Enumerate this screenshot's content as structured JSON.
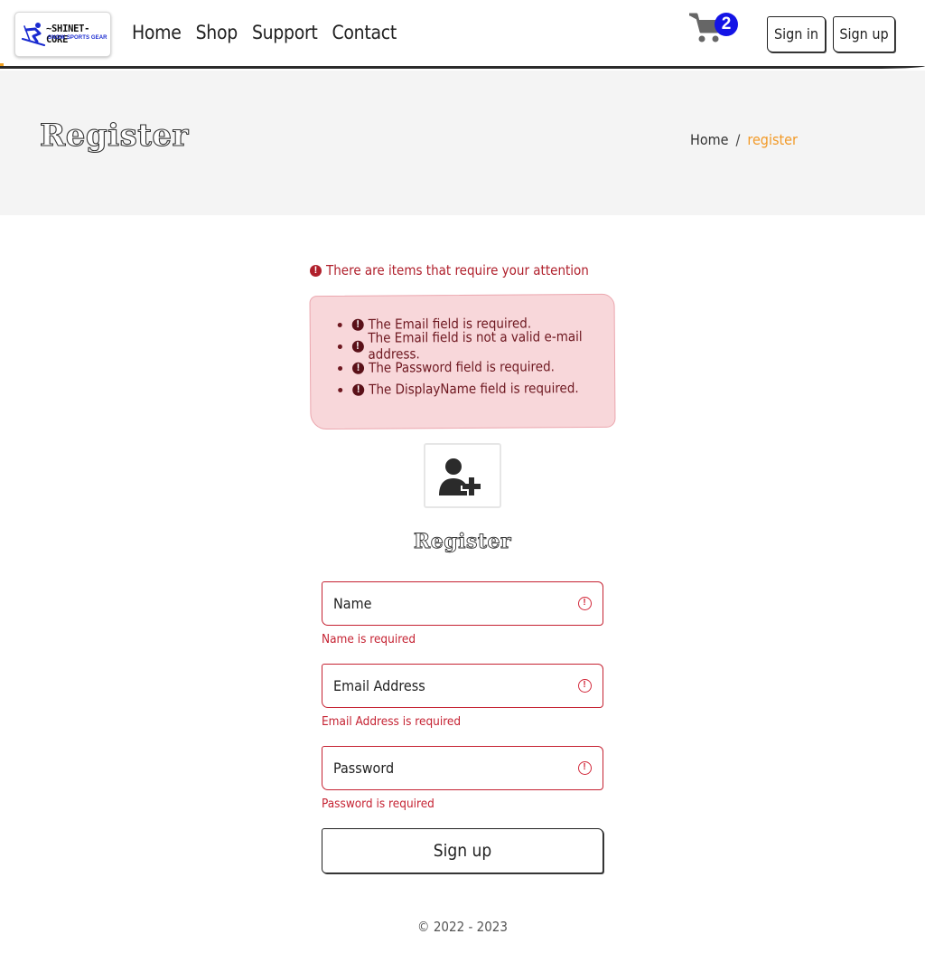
{
  "header": {
    "logo_title": "~SHINET-CORE",
    "logo_subtitle": "SNOW SPORTS GEAR",
    "nav": [
      "Home",
      "Shop",
      "Support",
      "Contact"
    ],
    "cart_count": "2",
    "signin_label": "Sign in",
    "signup_label": "Sign up"
  },
  "banner": {
    "title": "Register",
    "breadcrumb": {
      "home": "Home",
      "separator": "/",
      "current": "register"
    }
  },
  "validation": {
    "attention": "There are items that require your attention",
    "errors": [
      "The Email field is required.",
      "The Email field is not a valid e-mail address.",
      "The Password field is required.",
      "The DisplayName field is required."
    ]
  },
  "form": {
    "title": "Register",
    "fields": {
      "name": {
        "placeholder": "Name",
        "value": "",
        "error": "Name is required"
      },
      "email": {
        "placeholder": "Email Address",
        "value": "",
        "error": "Email Address is required"
      },
      "password": {
        "placeholder": "Password",
        "value": "",
        "error": "Password is required"
      }
    },
    "submit_label": "Sign up"
  },
  "footer": {
    "copyright": "© 2022 - 2023"
  },
  "colors": {
    "accent": "#f29a28",
    "error": "#c52232",
    "badge": "#1414e6",
    "alert_bg": "#f8d7da"
  },
  "icons": [
    "skier-icon",
    "cart-icon",
    "exclamation-circle-icon",
    "user-plus-icon"
  ]
}
